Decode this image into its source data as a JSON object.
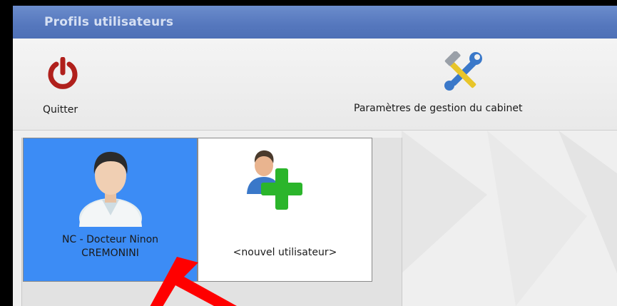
{
  "window": {
    "title": "Profils utilisateurs"
  },
  "toolbar": {
    "quit_label": "Quitter",
    "settings_label": "Paramètres de gestion du cabinet"
  },
  "profiles": {
    "user": {
      "line1": "NC - Docteur Ninon",
      "line2": "CREMONINI"
    },
    "new_user_label": "<nouvel utilisateur>"
  },
  "colors": {
    "titlebar": "#5577bd",
    "selected_tile": "#3c8cf5",
    "quit_icon": "#b0201c",
    "add_icon": "#2bb52b",
    "annotation_arrow": "#ff0000"
  },
  "icons": {
    "quit": "power-icon",
    "settings": "hammer-wrench-icon",
    "user": "doctor-avatar-icon",
    "new_user": "add-user-icon"
  }
}
